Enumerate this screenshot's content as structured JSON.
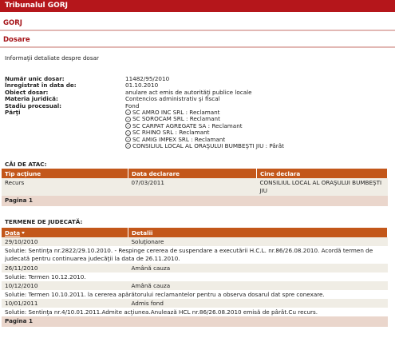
{
  "header": {
    "title": "Tribunalul GORJ"
  },
  "court_name": "GORJ",
  "section_title": "Dosare",
  "intro": "Informaţii detaliate despre dosar",
  "fields": [
    {
      "label": "Număr unic dosar:",
      "value": "11482/95/2010"
    },
    {
      "label": "Înregistrat în data de:",
      "value": "01.10.2010"
    },
    {
      "label": "Obiect dosar:",
      "value": "anulare act emis de autorităţi publice locale"
    },
    {
      "label": "Materia juridică:",
      "value": "Contencios administrativ şi fiscal"
    },
    {
      "label": "Stadiu procesual:",
      "value": "Fond"
    }
  ],
  "parties_label": "Părţi",
  "parties": [
    "SC AMRO INC SRL : Reclamant",
    "SC SOROCAM SRL : Reclamant",
    "SC CARPAT AGREGATE SA : Reclamant",
    "SC RHINO SRL : Reclamant",
    "SC AMIG IMPEX SRL : Reclamant",
    "CONSILIUL LOCAL AL ORAŞULUI BUMBEŞTI JIU : Pârât"
  ],
  "appeals": {
    "heading": "CĂI DE ATAC:",
    "columns": [
      "Tip acţiune",
      "Data declarare",
      "Cine declara"
    ],
    "rows": [
      {
        "type": "Recurs",
        "date": "07/03/2011",
        "who": "CONSILIUL LOCAL AL ORAŞULUI BUMBEŞTI JIU"
      }
    ],
    "pager": "Pagina 1"
  },
  "hearings": {
    "heading": "TERMENE DE JUDECATĂ:",
    "columns": [
      "Data",
      "Detalii"
    ],
    "rows": [
      {
        "date": "29/10/2010",
        "detail": "Soluţionare",
        "solution": "Solutie: Sentinţa nr.2822/29.10.2010. - Respinge cererea de suspendare a executării H.C.L. nr.86/26.08.2010. Acordă termen de judecată pentru continuarea judecăţii la data de 26.11.2010."
      },
      {
        "date": "26/11/2010",
        "detail": "Amână cauza",
        "solution": "Solutie: Termen 10.12.2010."
      },
      {
        "date": "10/12/2010",
        "detail": "Amână cauza",
        "solution": "Solutie: Termen 10.10.2011. la cererea apărătorului reclamantelor pentru a observa dosarul dat spre conexare."
      },
      {
        "date": "10/01/2011",
        "detail": "Admis fond",
        "solution": "Solutie: Sentinţa nr.4/10.01.2011.Admite acţiunea.Anulează HCL nr.86/26.08.2010 emisă de pârât.Cu recurs."
      }
    ],
    "pager": "Pagina 1"
  }
}
